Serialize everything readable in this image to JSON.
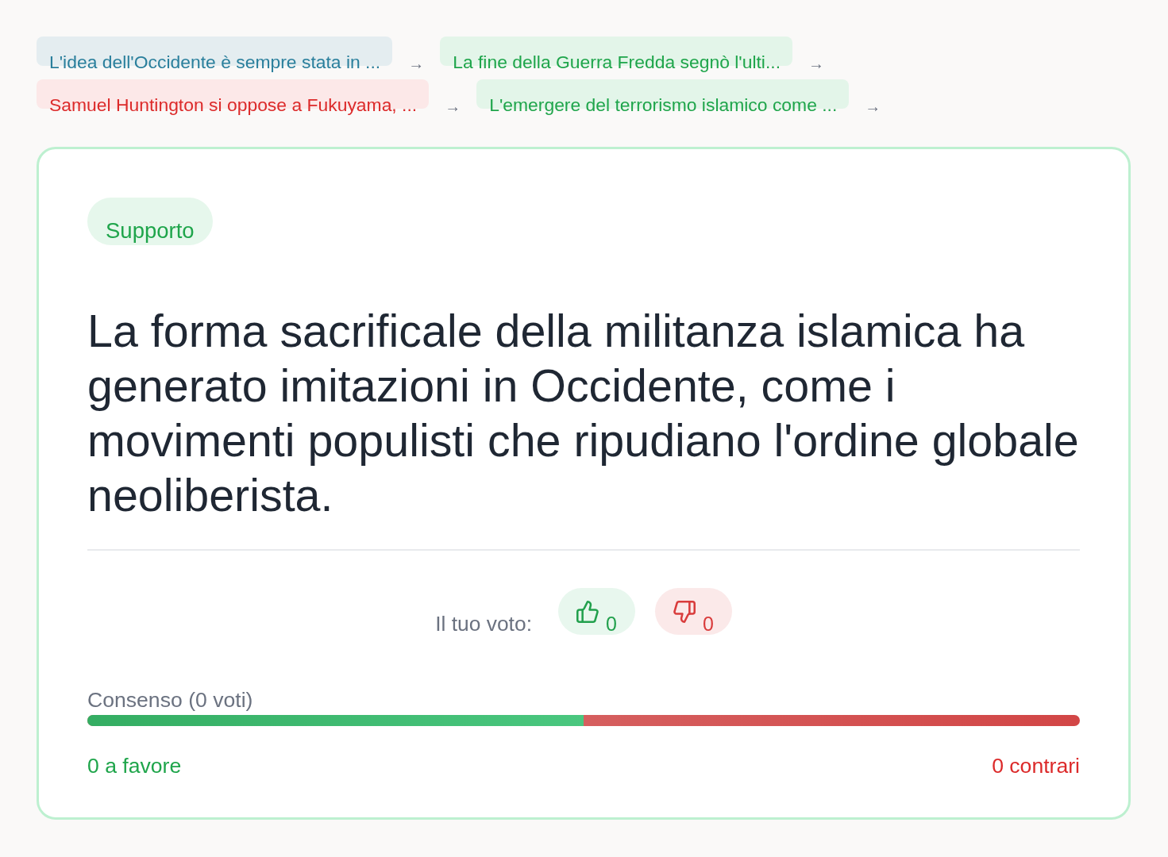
{
  "breadcrumb": [
    {
      "kind": "thesis",
      "text": "L'idea dell'Occidente è sempre stata in ...",
      "arrow": "→"
    },
    {
      "kind": "support",
      "text": "La fine della Guerra Fredda segnò l'ulti...",
      "arrow": "→"
    },
    {
      "kind": "oppose",
      "text": "Samuel Huntington si oppose a Fukuyama, ...",
      "arrow": "→"
    },
    {
      "kind": "support",
      "text": "L'emergere del terrorismo islamico come ...",
      "arrow": "→"
    }
  ],
  "card": {
    "badge": {
      "kind": "support",
      "label": "Supporto"
    },
    "statement": "La forma sacrificale della militanza islamica ha generato imitazioni in Occidente, come i movimenti populisti che ripudiano l'ordine globale neoliberista.",
    "vote": {
      "label": "Il tuo voto:",
      "buttons": [
        {
          "kind": "up",
          "count": "0"
        },
        {
          "kind": "down",
          "count": "0"
        }
      ]
    },
    "consensus": {
      "label": "Consenso (0 voti)",
      "level": 0.5,
      "in_favor": "0 a favore",
      "against": "0 contrari"
    }
  }
}
